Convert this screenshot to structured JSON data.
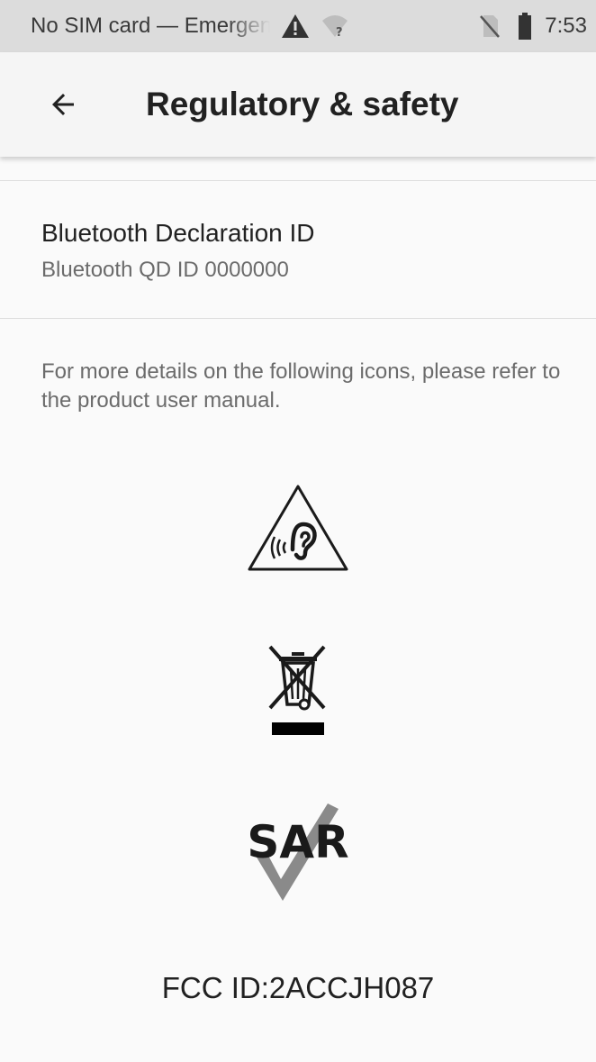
{
  "status_bar": {
    "carrier_text": "No SIM card — Emergency calls only",
    "time": "7:53",
    "icons": [
      "warning-icon",
      "wifi-unknown-icon",
      "no-sim-icon",
      "battery-icon"
    ]
  },
  "app_bar": {
    "back_icon": "arrow-back-icon",
    "title": "Regulatory & safety"
  },
  "bluetooth": {
    "title": "Bluetooth Declaration ID",
    "summary": "Bluetooth QD ID 0000000"
  },
  "info_text": "For more details on the following icons, please refer to the product user manual.",
  "regulatory_icons": [
    "hearing-warning-icon",
    "weee-crossed-bin-icon",
    "sar-check-icon"
  ],
  "sar_logo": {
    "text": "SAR"
  },
  "fcc_id": "FCC ID:2ACCJH087"
}
